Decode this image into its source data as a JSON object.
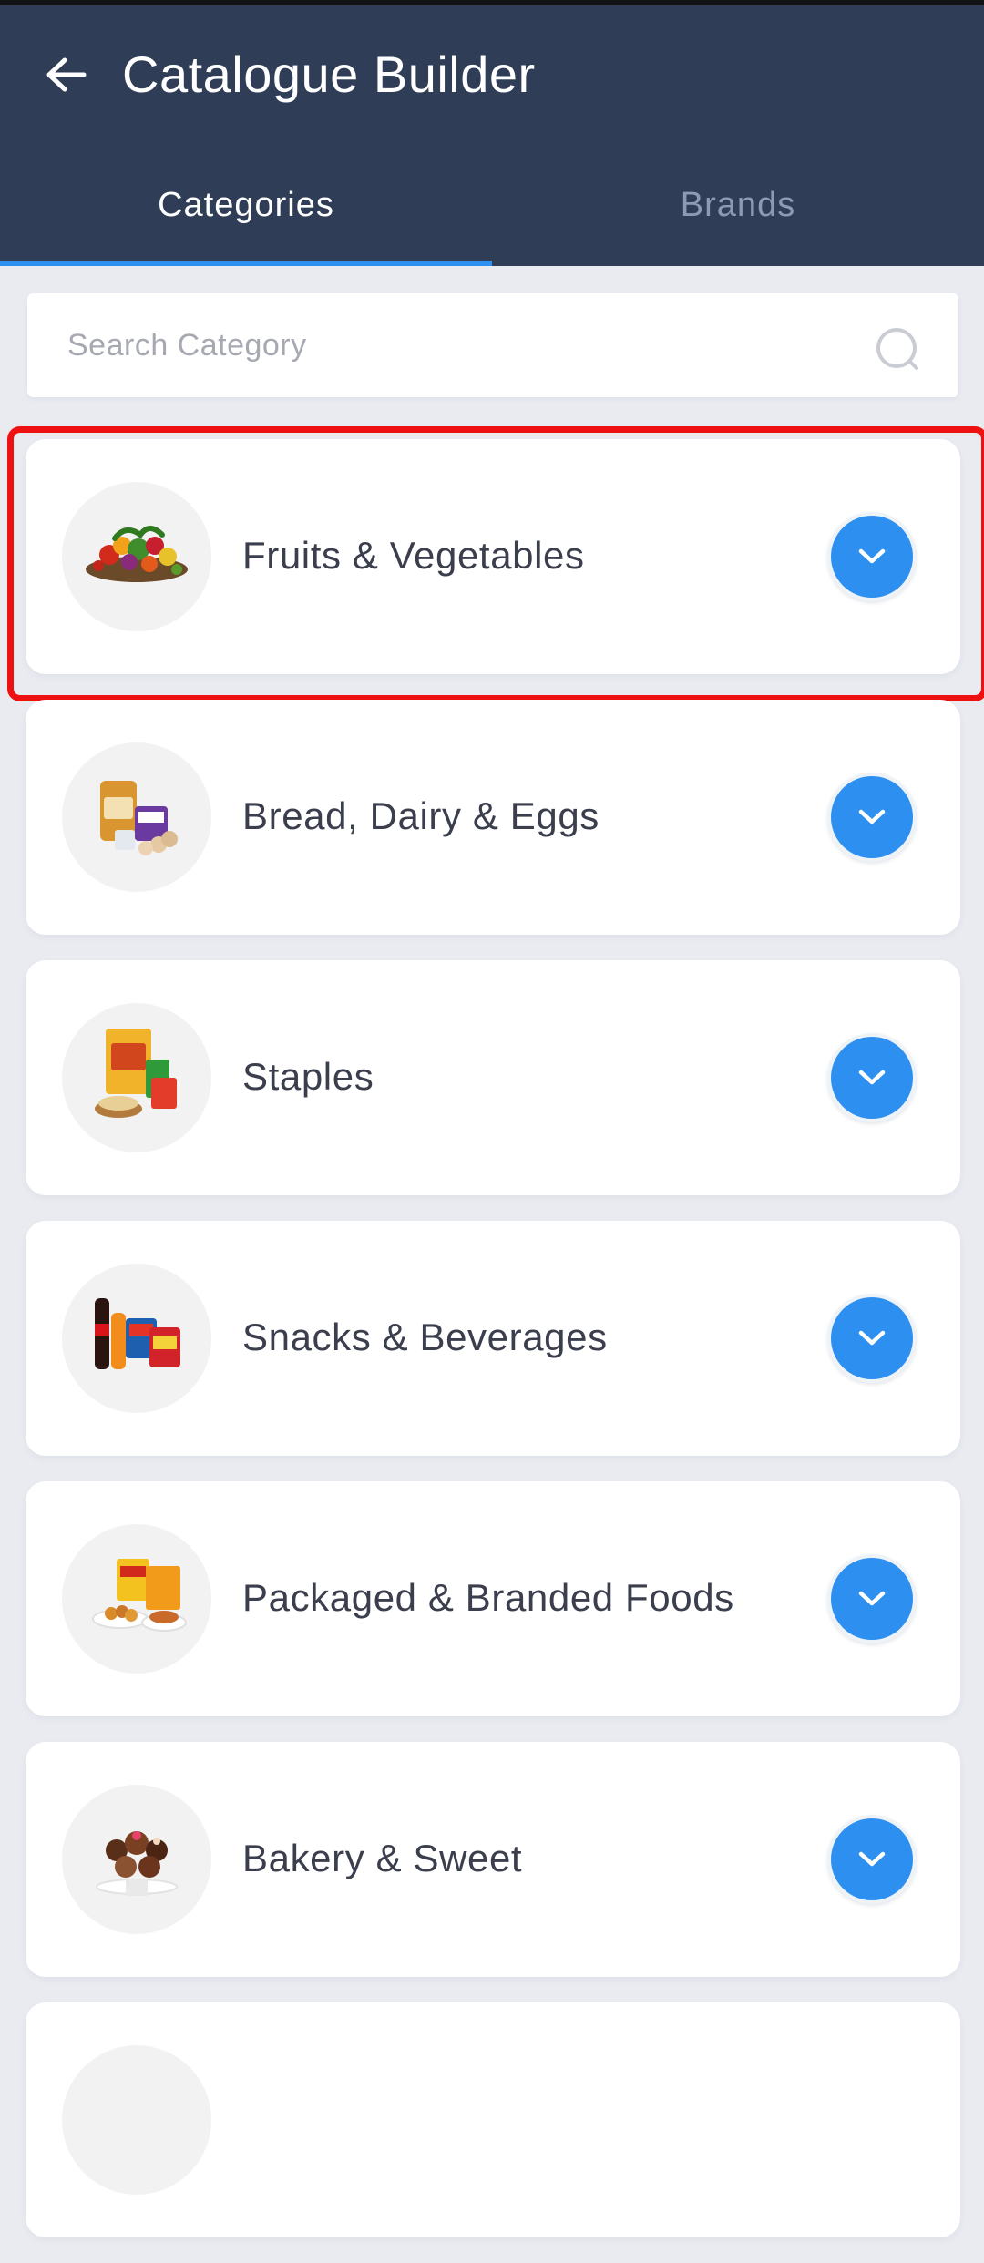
{
  "header": {
    "title": "Catalogue Builder",
    "back_icon": "arrow-left-icon",
    "bg_color": "#2f3d57"
  },
  "tabs": [
    {
      "label": "Categories",
      "active": true
    },
    {
      "label": "Brands",
      "active": false
    }
  ],
  "accent_color": "#2d8ff0",
  "search": {
    "placeholder": "Search Category",
    "value": "",
    "icon": "search-icon"
  },
  "categories": [
    {
      "label": "Fruits & Vegetables",
      "image": "fruits-vegetables-image",
      "highlighted": true
    },
    {
      "label": "Bread, Dairy & Eggs",
      "image": "bread-dairy-eggs-image",
      "highlighted": false
    },
    {
      "label": "Staples",
      "image": "staples-image",
      "highlighted": false
    },
    {
      "label": "Snacks & Beverages",
      "image": "snacks-beverages-image",
      "highlighted": false
    },
    {
      "label": "Packaged & Branded Foods",
      "image": "packaged-foods-image",
      "highlighted": false
    },
    {
      "label": "Bakery & Sweet",
      "image": "bakery-sweet-image",
      "highlighted": false
    },
    {
      "label": "",
      "image": "",
      "highlighted": false
    }
  ],
  "expand_icon": "chevron-down-icon",
  "highlight_color": "#ee1111"
}
